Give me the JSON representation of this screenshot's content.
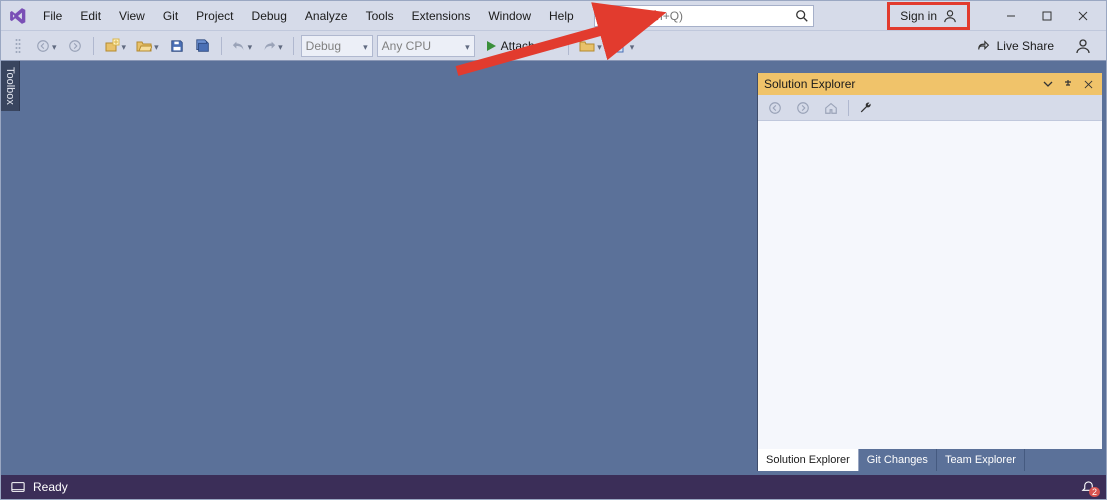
{
  "menubar": {
    "items": [
      "File",
      "Edit",
      "View",
      "Git",
      "Project",
      "Debug",
      "Analyze",
      "Tools",
      "Extensions",
      "Window",
      "Help"
    ],
    "search_placeholder": "Search (Ctrl+Q)",
    "signin_label": "Sign in"
  },
  "toolbar": {
    "config_combo": "Debug",
    "platform_combo": "Any CPU",
    "start_label": "Attach..."
  },
  "live_share_label": "Live Share",
  "toolbox_tab_label": "Toolbox",
  "solution_explorer": {
    "title": "Solution Explorer",
    "tabs": [
      "Solution Explorer",
      "Git Changes",
      "Team Explorer"
    ]
  },
  "statusbar": {
    "ready_label": "Ready",
    "notification_count": "2"
  }
}
